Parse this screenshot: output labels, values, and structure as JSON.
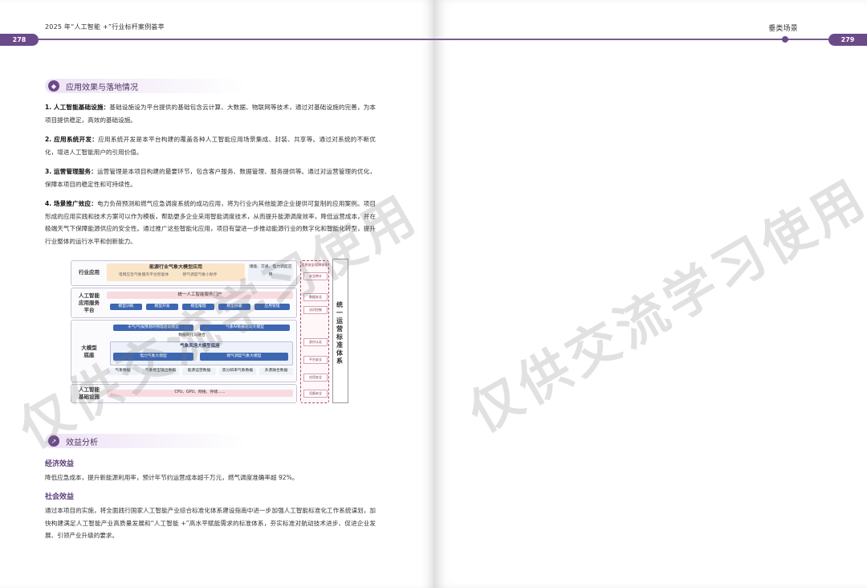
{
  "left_page": {
    "header_title": "2025 年“人工智能 +”行业标杆案例荟萃",
    "page_number": "278",
    "section1": {
      "title": "应用效果与落地情况",
      "items": [
        {
          "label": "1. 人工智能基础设施：",
          "text": "基础设施设为平台提供的基础包含云计算、大数据、物联网等技术，通过对基础设施的完善，为本项目提供稳定，高效的基础设施。"
        },
        {
          "label": "2. 应用系统开发：",
          "text": "应用系统开发是本平台构建的覆盖各种人工智能应用场景集成、封装、共享等。通过对系统的不断优化，增进人工智能用户的引用价值。"
        },
        {
          "label": "3. 运营管理服务：",
          "text": "运营管理是本项目构建的最要环节，包含客户服务、数据管理、服务提供等。通过对运营管理的优化，保障本项目的稳定性和可持续性。"
        },
        {
          "label": "4. 场景推广效应：",
          "text": "电力负荷预测和燃气应急调度系统的成功应用，将为行业内其他能源企业提供可复制的应用案例。项目形成的应用实践和技术方案可以作为模板，帮助更多企业采用智能调度技术，从而提升能源调度效率，降低运营成本，并在极端天气下保障能源供应的安全性。通过推广这些智能化应用，项目有望进一步推动能源行业的数字化和智能化转型，提升行业整体的运行水平和创新能力。"
        }
      ]
    },
    "diagram": {
      "layers": [
        {
          "label": "行业应用",
          "boxes": [
            "能源行业气象大模型应用",
            "电网应急气象服务平台智能体",
            "燃气调度气象小助手",
            "储能、交通、电力调度应用"
          ]
        },
        {
          "label": "人工智能\n应用服务\n平台",
          "boxes": [
            "统一人工智能服务门户",
            "模型训练",
            "模型开发",
            "模型推理",
            "模型部署",
            "应用管理"
          ]
        },
        {
          "label": "大模型\n底座",
          "boxes": [
            "天气/气候预测的物理驱动模型",
            "气象AI数据驱动大模型",
            "数据同化与融合",
            "气象风场大模型底座",
            "电力气象大模型",
            "燃气调度气象大模型",
            "气象数据",
            "气象模型输出数据",
            "能源运营数据",
            "高分辨率气象数据",
            "多源融合数据"
          ]
        },
        {
          "label": "人工智能\n基础设施",
          "boxes": [
            "CPU、GPU、网络、存储……"
          ]
        }
      ],
      "side_title": "信息安全保障体系",
      "side_boxes": [
        "安全审计",
        "数据安全",
        "访问控制",
        "身份认证",
        "平台安全",
        "应用安全",
        "设备安全"
      ],
      "standard_label": "统一运营标准体系"
    },
    "section2": {
      "title": "效益分析",
      "economic_title": "经济效益",
      "economic_text": "降低应急成本，提升新能源利用率，预计年节约运营成本超千万元，燃气调度准确率超 92%。",
      "social_title": "社会效益",
      "social_text": "通过本项目的实施，将全面践行国家人工智能产业综合标准化体系建设指南中进一步加强人工智能标准化工作系统谋划，加快构建满足人工智能产业高质量发展和“人工智能 +”高水平赋能需求的标准体系，夯实标准对航动技术进步、促进企业发展、引领产业升级的要求。"
    },
    "watermark": "仅供交流学习使用"
  },
  "right_page": {
    "header_title": "垂类场景",
    "page_number": "279",
    "watermark": "仅供交流学习使用"
  },
  "colors": {
    "accent": "#6b4a8a",
    "blue_box": "#3d67b1",
    "yellow_box": "#fbe5c8"
  }
}
